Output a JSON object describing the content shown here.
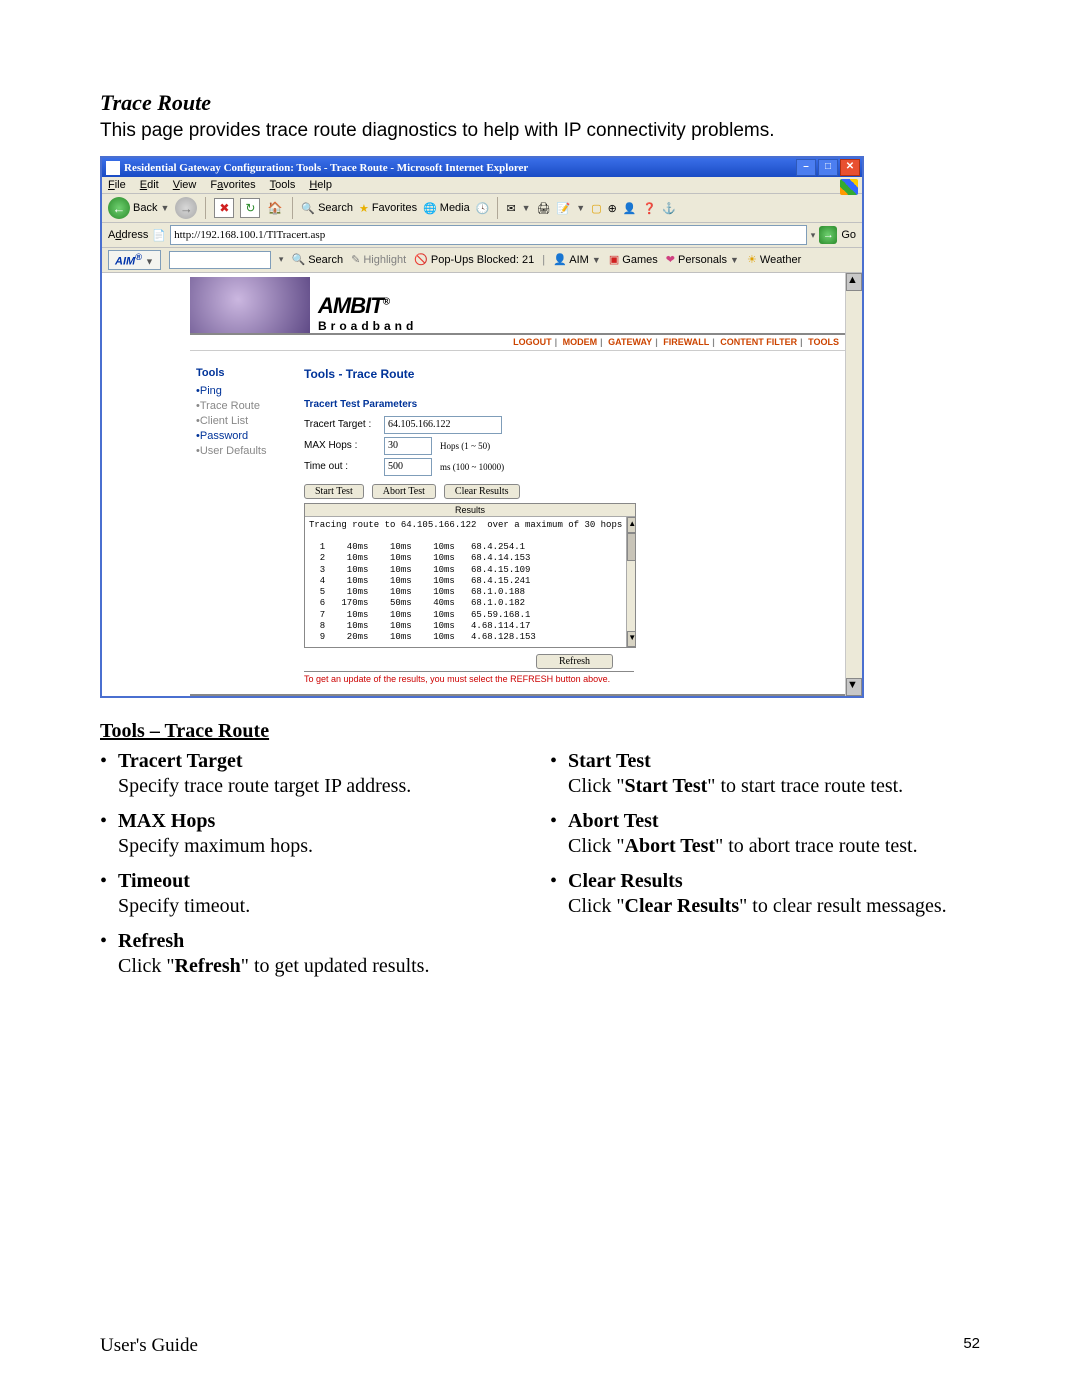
{
  "doc": {
    "section_title": "Trace Route",
    "section_desc": "This page provides trace route diagnostics to help with IP connectivity problems.",
    "heading": "Tools – Trace Route",
    "left_items": [
      {
        "term": "Tracert Target",
        "desc": "Specify trace route target IP address."
      },
      {
        "term": "MAX Hops",
        "desc": "Specify maximum hops."
      },
      {
        "term": "Timeout",
        "desc": "Specify timeout."
      }
    ],
    "right_items": [
      {
        "term": "Start Test",
        "desc_pre": "Click \"",
        "desc_bold": "Start Test",
        "desc_post": "\" to start trace route test."
      },
      {
        "term": "Abort Test",
        "desc_pre": "Click \"",
        "desc_bold": "Abort Test",
        "desc_post": "\" to abort trace route test."
      },
      {
        "term": "Clear Results",
        "desc_pre": "Click \"",
        "desc_bold": "Clear Results",
        "desc_post": "\" to clear result messages."
      }
    ],
    "after_items": [
      {
        "term": "Refresh",
        "desc_pre": "Click \"",
        "desc_bold": "Refresh",
        "desc_post": "\" to get updated results."
      }
    ],
    "footer_left": "User's Guide",
    "footer_right": "52"
  },
  "ie": {
    "title": "Residential Gateway Configuration: Tools - Trace Route - Microsoft Internet Explorer",
    "menus": [
      "File",
      "Edit",
      "View",
      "Favorites",
      "Tools",
      "Help"
    ],
    "toolbar": {
      "back": "Back",
      "search": "Search",
      "favorites": "Favorites",
      "media": "Media"
    },
    "address_label": "Address",
    "address_value": "http://192.168.100.1/TlTracert.asp",
    "go": "Go",
    "aim": {
      "logo": "AIM",
      "search": "Search",
      "highlight": "Highlight",
      "popups": "Pop-Ups Blocked: 21",
      "aim_label": "AIM",
      "games": "Games",
      "personals": "Personals",
      "weather": "Weather"
    }
  },
  "gw": {
    "brand1": "AMBIT",
    "brand2": "Broadband",
    "tabs": [
      "LOGOUT",
      "MODEM",
      "GATEWAY",
      "FIREWALL",
      "CONTENT FILTER",
      "TOOLS"
    ],
    "sidebar": {
      "heading": "Tools",
      "items": [
        {
          "label": "Ping",
          "kind": "link"
        },
        {
          "label": "Trace Route",
          "kind": "grey"
        },
        {
          "label": "Client List",
          "kind": "grey"
        },
        {
          "label": "Password",
          "kind": "link"
        },
        {
          "label": "User Defaults",
          "kind": "grey"
        }
      ]
    },
    "page_title": "Tools - Trace Route",
    "subheading": "Tracert Test Parameters",
    "fields": {
      "target_label": "Tracert Target :",
      "target_value": "64.105.166.122",
      "hops_label": "MAX Hops :",
      "hops_value": "30",
      "hops_hint": "Hops (1 ~ 50)",
      "timeout_label": "Time out :",
      "timeout_value": "500",
      "timeout_hint": "ms (100 ~ 10000)"
    },
    "buttons": {
      "start": "Start Test",
      "abort": "Abort Test",
      "clear": "Clear Results",
      "refresh": "Refresh"
    },
    "results_heading": "Results",
    "results_intro": "Tracing route to 64.105.166.122  over a maximum of 30 hops",
    "hops": [
      {
        "n": "1",
        "t1": "40ms",
        "t2": "10ms",
        "t3": "10ms",
        "ip": "68.4.254.1"
      },
      {
        "n": "2",
        "t1": "10ms",
        "t2": "10ms",
        "t3": "10ms",
        "ip": "68.4.14.153"
      },
      {
        "n": "3",
        "t1": "10ms",
        "t2": "10ms",
        "t3": "10ms",
        "ip": "68.4.15.109"
      },
      {
        "n": "4",
        "t1": "10ms",
        "t2": "10ms",
        "t3": "10ms",
        "ip": "68.4.15.241"
      },
      {
        "n": "5",
        "t1": "10ms",
        "t2": "10ms",
        "t3": "10ms",
        "ip": "68.1.0.188"
      },
      {
        "n": "6",
        "t1": "170ms",
        "t2": "50ms",
        "t3": "40ms",
        "ip": "68.1.0.182"
      },
      {
        "n": "7",
        "t1": "10ms",
        "t2": "10ms",
        "t3": "10ms",
        "ip": "65.59.168.1"
      },
      {
        "n": "8",
        "t1": "10ms",
        "t2": "10ms",
        "t3": "10ms",
        "ip": "4.68.114.17"
      },
      {
        "n": "9",
        "t1": "20ms",
        "t2": "10ms",
        "t3": "10ms",
        "ip": "4.68.128.153"
      }
    ],
    "note": "To get an update of the results, you must select the REFRESH button above."
  }
}
